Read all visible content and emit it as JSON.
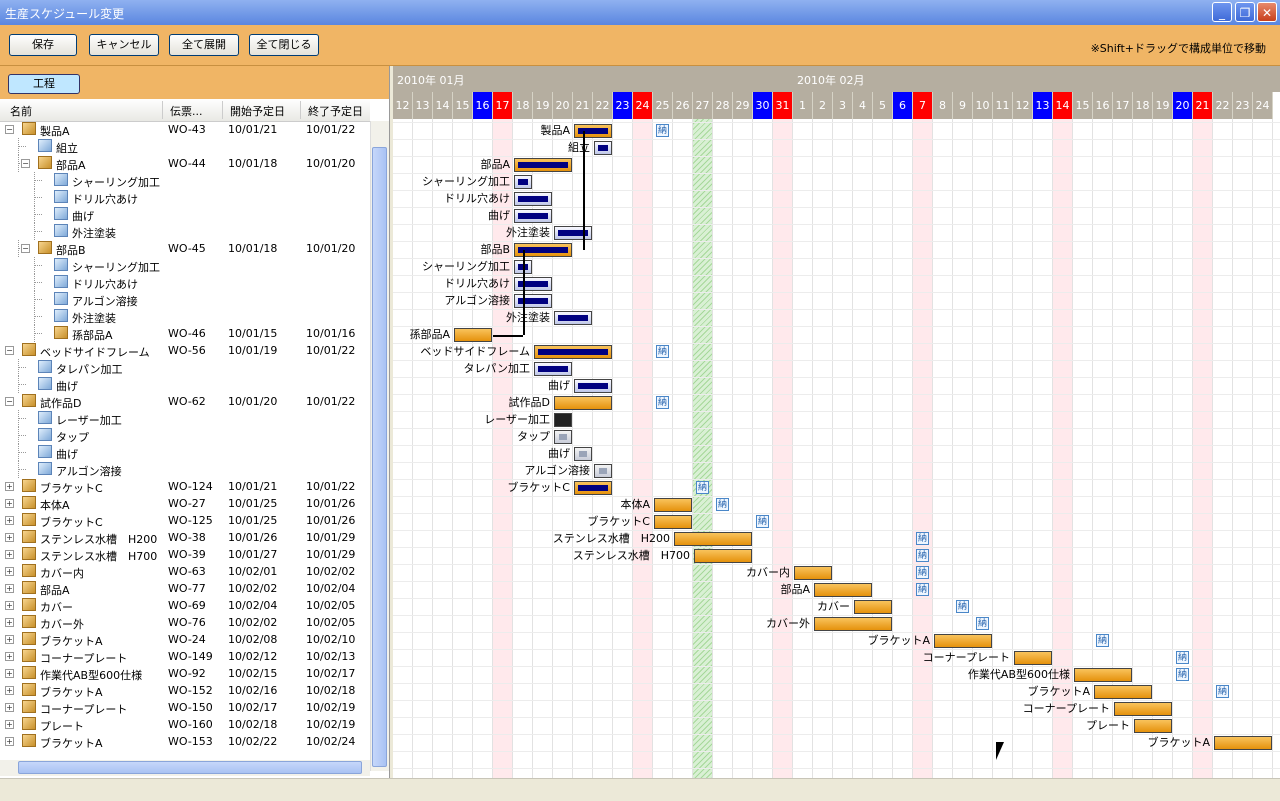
{
  "window": {
    "title": "生産スケジュール変更"
  },
  "toolbar": {
    "save": "保存",
    "cancel": "キャンセル",
    "expand_all": "全て展開",
    "collapse_all": "全て閉じる",
    "hint": "※Shift+ドラッグで構成単位で移動"
  },
  "left": {
    "tab": "工程",
    "columns": {
      "name": "名前",
      "slip": "伝票...",
      "start": "開始予定日",
      "end": "終了予定日"
    }
  },
  "gantt": {
    "months": [
      "2010年 01月",
      "2010年 02月"
    ],
    "days": [
      "12",
      "13",
      "14",
      "15",
      "16",
      "17",
      "18",
      "19",
      "20",
      "21",
      "22",
      "23",
      "24",
      "25",
      "26",
      "27",
      "28",
      "29",
      "30",
      "31",
      "1",
      "2",
      "3",
      "4",
      "5",
      "6",
      "7",
      "8",
      "9",
      "10",
      "11",
      "12",
      "13",
      "14",
      "15",
      "16",
      "17",
      "18",
      "19",
      "20",
      "21",
      "22",
      "23",
      "24"
    ],
    "day_types": [
      "",
      "",
      "",
      "",
      "sat",
      "sun",
      "",
      "",
      "",
      "",
      "",
      "sat",
      "sun",
      "",
      "",
      "today",
      "",
      "",
      "sat",
      "sun",
      "",
      "",
      "",
      "",
      "",
      "sat",
      "sun",
      "",
      "",
      "",
      "",
      "",
      "sat",
      "sun",
      "",
      "",
      "",
      "",
      "",
      "sat",
      "sun",
      "",
      "",
      ""
    ],
    "holiday_cols": [
      5,
      12,
      19,
      26,
      33,
      40
    ],
    "nou_label": "納"
  },
  "rows": [
    {
      "level": 0,
      "type": "prod",
      "exp": "−",
      "name": "製品A",
      "slip": "WO-43",
      "start": "10/01/21",
      "end": "10/01/22",
      "bar": {
        "s": 9,
        "e": 11,
        "k": "prodsel"
      },
      "nou": 13
    },
    {
      "level": 1,
      "type": "proc",
      "name": "組立",
      "bar": {
        "s": 10,
        "e": 11,
        "k": "proc"
      }
    },
    {
      "level": 1,
      "type": "prod",
      "exp": "−",
      "name": "部品A",
      "slip": "WO-44",
      "start": "10/01/18",
      "end": "10/01/20",
      "bar": {
        "s": 6,
        "e": 9,
        "k": "prodsel"
      }
    },
    {
      "level": 2,
      "type": "proc",
      "name": "シャーリング加工",
      "bar": {
        "s": 6,
        "e": 7,
        "k": "proc"
      }
    },
    {
      "level": 2,
      "type": "proc",
      "name": "ドリル穴あけ",
      "bar": {
        "s": 6,
        "e": 8,
        "k": "proc"
      }
    },
    {
      "level": 2,
      "type": "proc",
      "name": "曲げ",
      "bar": {
        "s": 6,
        "e": 8,
        "k": "proc"
      }
    },
    {
      "level": 2,
      "type": "proc",
      "name": "外注塗装",
      "bar": {
        "s": 8,
        "e": 10,
        "k": "proc"
      }
    },
    {
      "level": 1,
      "type": "prod",
      "exp": "−",
      "name": "部品B",
      "slip": "WO-45",
      "start": "10/01/18",
      "end": "10/01/20",
      "bar": {
        "s": 6,
        "e": 9,
        "k": "prodsel"
      }
    },
    {
      "level": 2,
      "type": "proc",
      "name": "シャーリング加工",
      "bar": {
        "s": 6,
        "e": 7,
        "k": "proc"
      }
    },
    {
      "level": 2,
      "type": "proc",
      "name": "ドリル穴あけ",
      "bar": {
        "s": 6,
        "e": 8,
        "k": "proc"
      }
    },
    {
      "level": 2,
      "type": "proc",
      "name": "アルゴン溶接",
      "bar": {
        "s": 6,
        "e": 8,
        "k": "proc"
      }
    },
    {
      "level": 2,
      "type": "proc",
      "name": "外注塗装",
      "bar": {
        "s": 8,
        "e": 10,
        "k": "proc"
      }
    },
    {
      "level": 2,
      "type": "prod",
      "name": "孫部品A",
      "slip": "WO-46",
      "start": "10/01/15",
      "end": "10/01/16",
      "bar": {
        "s": 3,
        "e": 5,
        "k": "prod"
      }
    },
    {
      "level": 0,
      "type": "prod",
      "exp": "−",
      "name": "ベッドサイドフレーム",
      "slip": "WO-56",
      "start": "10/01/19",
      "end": "10/01/22",
      "bar": {
        "s": 7,
        "e": 11,
        "k": "prodsel"
      },
      "nou": 13
    },
    {
      "level": 1,
      "type": "proc",
      "name": "タレパン加工",
      "bar": {
        "s": 7,
        "e": 9,
        "k": "proc"
      }
    },
    {
      "level": 1,
      "type": "proc",
      "name": "曲げ",
      "bar": {
        "s": 9,
        "e": 11,
        "k": "proc"
      }
    },
    {
      "level": 0,
      "type": "prod",
      "exp": "−",
      "name": "試作品D",
      "slip": "WO-62",
      "start": "10/01/20",
      "end": "10/01/22",
      "bar": {
        "s": 8,
        "e": 11,
        "k": "prod"
      },
      "nou": 13
    },
    {
      "level": 1,
      "type": "proc",
      "name": "レーザー加工",
      "bar": {
        "s": 8,
        "e": 9,
        "k": "dark"
      }
    },
    {
      "level": 1,
      "type": "proc",
      "name": "タップ",
      "bar": {
        "s": 8,
        "e": 9,
        "k": "procg"
      }
    },
    {
      "level": 1,
      "type": "proc",
      "name": "曲げ",
      "bar": {
        "s": 9,
        "e": 10,
        "k": "procg"
      }
    },
    {
      "level": 1,
      "type": "proc",
      "name": "アルゴン溶接",
      "bar": {
        "s": 10,
        "e": 11,
        "k": "procg"
      }
    },
    {
      "level": 0,
      "type": "prod",
      "exp": "+",
      "name": "ブラケットC",
      "slip": "WO-124",
      "start": "10/01/21",
      "end": "10/01/22",
      "bar": {
        "s": 9,
        "e": 11,
        "k": "prodsel"
      },
      "nou": 15
    },
    {
      "level": 0,
      "type": "prod",
      "exp": "+",
      "name": "本体A",
      "slip": "WO-27",
      "start": "10/01/25",
      "end": "10/01/26",
      "bar": {
        "s": 13,
        "e": 15,
        "k": "prod"
      },
      "nou": 16
    },
    {
      "level": 0,
      "type": "prod",
      "exp": "+",
      "name": "ブラケットC",
      "slip": "WO-125",
      "start": "10/01/25",
      "end": "10/01/26",
      "bar": {
        "s": 13,
        "e": 15,
        "k": "prod"
      },
      "nou": 18
    },
    {
      "level": 0,
      "type": "prod",
      "exp": "+",
      "name": "ステンレス水槽　H200",
      "slip": "WO-38",
      "start": "10/01/26",
      "end": "10/01/29",
      "bar": {
        "s": 14,
        "e": 18,
        "k": "prod"
      },
      "nou": 26
    },
    {
      "level": 0,
      "type": "prod",
      "exp": "+",
      "name": "ステンレス水槽　H700",
      "slip": "WO-39",
      "start": "10/01/27",
      "end": "10/01/29",
      "bar": {
        "s": 15,
        "e": 18,
        "k": "prod"
      },
      "nou": 26
    },
    {
      "level": 0,
      "type": "prod",
      "exp": "+",
      "name": "カバー内",
      "slip": "WO-63",
      "start": "10/02/01",
      "end": "10/02/02",
      "bar": {
        "s": 20,
        "e": 22,
        "k": "prod"
      },
      "nou": 26
    },
    {
      "level": 0,
      "type": "prod",
      "exp": "+",
      "name": "部品A",
      "slip": "WO-77",
      "start": "10/02/02",
      "end": "10/02/04",
      "bar": {
        "s": 21,
        "e": 24,
        "k": "prod"
      },
      "nou": 26
    },
    {
      "level": 0,
      "type": "prod",
      "exp": "+",
      "name": "カバー",
      "slip": "WO-69",
      "start": "10/02/04",
      "end": "10/02/05",
      "bar": {
        "s": 23,
        "e": 25,
        "k": "prod"
      },
      "nou": 28
    },
    {
      "level": 0,
      "type": "prod",
      "exp": "+",
      "name": "カバー外",
      "slip": "WO-76",
      "start": "10/02/02",
      "end": "10/02/05",
      "bar": {
        "s": 21,
        "e": 25,
        "k": "prod"
      },
      "nou": 29
    },
    {
      "level": 0,
      "type": "prod",
      "exp": "+",
      "name": "ブラケットA",
      "slip": "WO-24",
      "start": "10/02/08",
      "end": "10/02/10",
      "bar": {
        "s": 27,
        "e": 30,
        "k": "prod"
      },
      "nou": 35
    },
    {
      "level": 0,
      "type": "prod",
      "exp": "+",
      "name": "コーナープレート",
      "slip": "WO-149",
      "start": "10/02/12",
      "end": "10/02/13",
      "bar": {
        "s": 31,
        "e": 33,
        "k": "prod"
      },
      "nou": 39
    },
    {
      "level": 0,
      "type": "prod",
      "exp": "+",
      "name": "作業代AB型600仕様",
      "slip": "WO-92",
      "start": "10/02/15",
      "end": "10/02/17",
      "bar": {
        "s": 34,
        "e": 37,
        "k": "prod"
      },
      "nou": 39
    },
    {
      "level": 0,
      "type": "prod",
      "exp": "+",
      "name": "ブラケットA",
      "slip": "WO-152",
      "start": "10/02/16",
      "end": "10/02/18",
      "bar": {
        "s": 35,
        "e": 38,
        "k": "prod"
      },
      "nou": 41
    },
    {
      "level": 0,
      "type": "prod",
      "exp": "+",
      "name": "コーナープレート",
      "slip": "WO-150",
      "start": "10/02/17",
      "end": "10/02/19",
      "bar": {
        "s": 36,
        "e": 39,
        "k": "prod"
      }
    },
    {
      "level": 0,
      "type": "prod",
      "exp": "+",
      "name": "プレート",
      "slip": "WO-160",
      "start": "10/02/18",
      "end": "10/02/19",
      "bar": {
        "s": 37,
        "e": 39,
        "k": "prod"
      }
    },
    {
      "level": 0,
      "type": "prod",
      "exp": "+",
      "name": "ブラケットA",
      "slip": "WO-153",
      "start": "10/02/22",
      "end": "10/02/24",
      "bar": {
        "s": 41,
        "e": 44,
        "k": "prod"
      }
    }
  ]
}
